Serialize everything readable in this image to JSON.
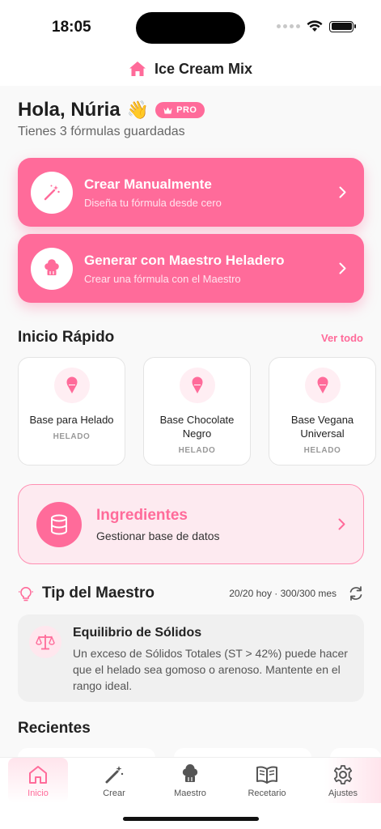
{
  "status": {
    "time": "18:05"
  },
  "header": {
    "title": "Ice Cream Mix",
    "icon": "home-icon"
  },
  "greeting": {
    "text": "Hola, Núria",
    "emoji": "👋",
    "badge": "PRO",
    "subtitle": "Tienes 3 fórmulas guardadas"
  },
  "actions": [
    {
      "title": "Crear Manualmente",
      "subtitle": "Diseña tu fórmula desde cero",
      "icon": "magic-wand-icon"
    },
    {
      "title": "Generar con Maestro Heladero",
      "subtitle": "Crear una fórmula con el Maestro",
      "icon": "chef-hat-icon"
    }
  ],
  "quick_start": {
    "title": "Inicio Rápido",
    "see_all": "Ver todo",
    "items": [
      {
        "name": "Base para Helado",
        "tag": "HELADO"
      },
      {
        "name": "Base Chocolate Negro",
        "tag": "HELADO"
      },
      {
        "name": "Base Vegana Universal",
        "tag": "HELADO"
      }
    ]
  },
  "ingredients": {
    "title": "Ingredientes",
    "subtitle": "Gestionar base de datos",
    "icon": "database-icon"
  },
  "tip": {
    "title": "Tip del Maestro",
    "quota": "20/20 hoy · 300/300 mes",
    "card_title": "Equilibrio de Sólidos",
    "card_body": "Un exceso de Sólidos Totales (ST > 42%) puede hacer que el helado sea gomoso o arenoso. Mantente en el rango ideal."
  },
  "recent": {
    "title": "Recientes"
  },
  "tabs": [
    {
      "label": "Inicio",
      "icon": "home-icon",
      "active": true
    },
    {
      "label": "Crear",
      "icon": "pencil-icon",
      "active": false
    },
    {
      "label": "Maestro",
      "icon": "chef-hat-icon",
      "active": false
    },
    {
      "label": "Recetario",
      "icon": "book-icon",
      "active": false
    },
    {
      "label": "Ajustes",
      "icon": "gear-icon",
      "active": false
    }
  ],
  "colors": {
    "accent": "#ff6b9a",
    "accent_light": "#fdeaf0"
  }
}
